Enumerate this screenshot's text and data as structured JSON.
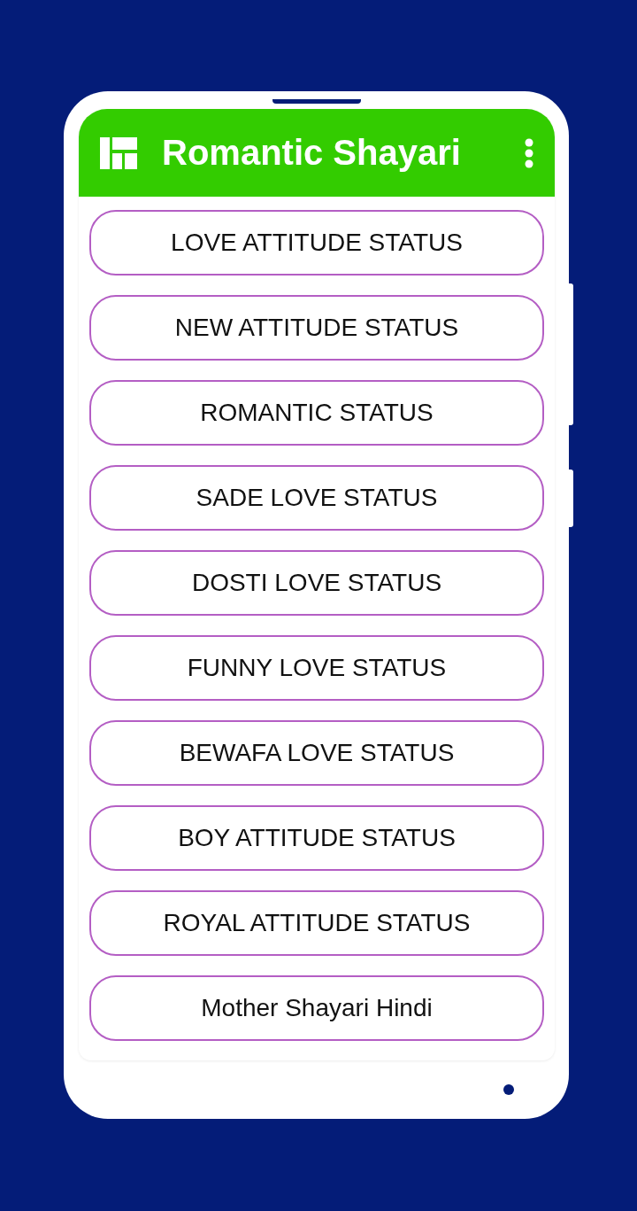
{
  "app_bar": {
    "title": "Romantic Shayari"
  },
  "items": [
    {
      "label": "LOVE ATTITUDE STATUS"
    },
    {
      "label": "NEW ATTITUDE STATUS"
    },
    {
      "label": "ROMANTIC STATUS"
    },
    {
      "label": "SADE LOVE STATUS"
    },
    {
      "label": "DOSTI LOVE STATUS"
    },
    {
      "label": "FUNNY LOVE STATUS"
    },
    {
      "label": "BEWAFA LOVE STATUS"
    },
    {
      "label": "BOY ATTITUDE STATUS"
    },
    {
      "label": "ROYAL ATTITUDE STATUS"
    },
    {
      "label": "Mother Shayari Hindi"
    }
  ]
}
